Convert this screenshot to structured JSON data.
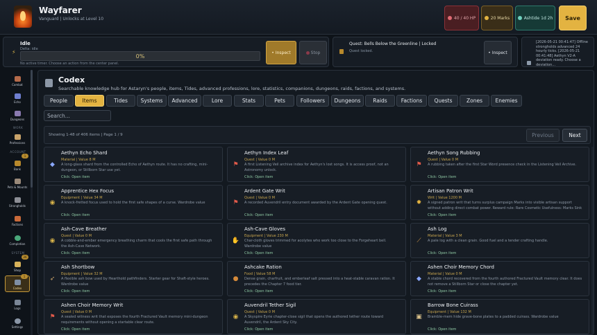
{
  "header": {
    "title": "Wayfarer",
    "subtitle": "Vanguard | Unlocks at Level 10",
    "hp": "40 / 40 HP",
    "marks": "20 Marks",
    "time": "Ashtide 1d 2h",
    "save_label": "Save",
    "colors": {
      "accent": "#e3b341",
      "hp": "#8b3138",
      "time": "#2d7a6e"
    }
  },
  "activity": {
    "title": "Idle",
    "delta": "Delta: idle",
    "progress_label": "0%",
    "progress_fraction": 0,
    "hint": "No active timer. Choose an action from the center panel.",
    "inspect_label": "Inspect",
    "stop_label": "Stop",
    "quest_title": "Quest: Bells Below the Greenline | Locked",
    "quest_sub": "Quest locked.",
    "quest_inspect_label": "Inspect",
    "log_text": "[2026-05-21 00:41:47] Offline strongholds advanced 24 hourly ticks. [2026-05-21 00:41:48] Aethyn V2-A deviation ready. Choose a deviation…"
  },
  "sidebar": {
    "items": [
      {
        "label": "Combat",
        "icon": "swords-icon"
      },
      {
        "label": "Echo",
        "icon": "echo-icon"
      },
      {
        "label": "Dungeons",
        "icon": "dungeon-icon"
      },
      {
        "label": "Professions",
        "icon": "tools-icon"
      },
      {
        "label": "Bank",
        "icon": "bank-icon",
        "badge": "1"
      },
      {
        "label": "Pets & Mounts",
        "icon": "paw-icon"
      },
      {
        "label": "Strongholds",
        "icon": "castle-icon"
      },
      {
        "label": "Factions",
        "icon": "banner-icon"
      },
      {
        "label": "Completion",
        "icon": "check-icon"
      },
      {
        "label": "Shop",
        "icon": "shop-icon",
        "badge": "26"
      },
      {
        "label": "Codex",
        "icon": "book-icon",
        "badge": "1",
        "active": true
      },
      {
        "label": "Logs",
        "icon": "scroll-icon"
      },
      {
        "label": "Settings",
        "icon": "gear-icon"
      }
    ],
    "sections": {
      "work": "WORK",
      "account": "ACCOUNT",
      "system": "SYSTEM"
    }
  },
  "codex": {
    "title": "Codex",
    "subtitle": "Searchable knowledge hub for Astaryn's people, items, Tides, advanced professions, lore, statistics, companions, dungeons, raids, factions, and systems.",
    "tabs": [
      "People",
      "Items",
      "Tides",
      "Systems",
      "Advanced",
      "Lore",
      "Stats",
      "Pets",
      "Followers",
      "Dungeons",
      "Raids",
      "Factions",
      "Quests",
      "Zones",
      "Enemies"
    ],
    "active_tab": "Items",
    "search_placeholder": "Search...",
    "showing": "Showing 1-48 of 406 items | Page 1 / 9",
    "prev_label": "Previous",
    "next_label": "Next",
    "open_label": "Click: Open item",
    "cards": [
      {
        "title": "Aethyn Echo Shard",
        "meta": "Material | Value 8 M",
        "desc": "A long-glass shard from the controlled Echo of Aethyn route. It has no crafting, mini-dungeon, or Stillborn Star use yet.",
        "icon": "crystal-icon",
        "glyph": "◆",
        "color": "#8aa8ff"
      },
      {
        "title": "Aethyn Index Leaf",
        "meta": "Quest | Value 0 M",
        "desc": "A first Listening Veil archive index for Aethyn's lost songs. It is access proof, not an Astronomy unlock.",
        "icon": "flag-icon",
        "glyph": "⚑",
        "color": "#e05a4a"
      },
      {
        "title": "Aethyn Song Rubbing",
        "meta": "Quest | Value 0 M",
        "desc": "A rubbing taken after the first Star Word presence check in the Listening Veil Archive.",
        "icon": "flag-icon",
        "glyph": "⚑",
        "color": "#e05a4a"
      },
      {
        "title": "Apprentice Hex Focus",
        "meta": "Equipment | Value 34 M",
        "desc": "A knock-fretted focus used to hold the first safe shapes of a curse. Wardrobe value",
        "icon": "amulet-icon",
        "glyph": "◉",
        "color": "#d9b44a"
      },
      {
        "title": "Ardent Gate Writ",
        "meta": "Quest | Value 0 M",
        "desc": "A recorded Auvendril entry document awarded by the Ardent Gate opening quest.",
        "icon": "flag-icon",
        "glyph": "⚑",
        "color": "#e05a4a"
      },
      {
        "title": "Artisan Patron Writ",
        "meta": "Writ | Value 1200 M",
        "desc": "A signed patron writ that turns surplus campaign Marks into visible artisan support without adding direct combat power. Reward rule: Rare Cosmetic Usefulness: Marks Sink Prestige.",
        "icon": "seal-icon",
        "glyph": "✹",
        "color": "#e3b341"
      },
      {
        "title": "Ash-Cave Breather",
        "meta": "Quest | Value 0 M",
        "desc": "A cobble-and-ember emergency breathing charm that cools the first safe path through the Ash-Cave Network.",
        "icon": "amulet-icon",
        "glyph": "◉",
        "color": "#d9b44a"
      },
      {
        "title": "Ash-Cave Gloves",
        "meta": "Equipment | Value 230 M",
        "desc": "Char-cloth gloves trimmed for acolytes who work too close to the Forgeheart bell. Wardrobe value",
        "icon": "glove-icon",
        "glyph": "✋",
        "color": "#e0c290"
      },
      {
        "title": "Ash Log",
        "meta": "Material | Value 3 M",
        "desc": "A pale log with a clean grain. Good fuel and a tender crafting handle.",
        "icon": "log-icon",
        "glyph": "⟋",
        "color": "#d79a4a"
      },
      {
        "title": "Ash Shortbow",
        "meta": "Equipment | Value 32 M",
        "desc": "A flexible ash bow used by Hearthold pathfinders. Starter gear for Shaft-style heroes. Wardrobe value",
        "icon": "bow-icon",
        "glyph": "➶",
        "color": "#c9a36a"
      },
      {
        "title": "Ashcake Ration",
        "meta": "Food | Value 58 M",
        "desc": "Dense grain, charfruit, and emberleaf salt pressed into a heat-stable caravan ration. It precedes the Chapter 7 food tier.",
        "icon": "bread-icon",
        "glyph": "●",
        "color": "#d58a3a"
      },
      {
        "title": "Ashen Choir Memory Chord",
        "meta": "Material | Value 0 M",
        "desc": "A stable chord recovered from the fourth authored Fractured Vault memory clear. It does not remove a Stillborn Star or close the chapter yet.",
        "icon": "crystal-icon",
        "glyph": "◆",
        "color": "#8aa8ff"
      },
      {
        "title": "Ashen Choir Memory Writ",
        "meta": "Quest | Value 0 M",
        "desc": "A sealed witness writ that exposes the fourth Fractured Vault memory mini-dungeon requirements without opening a startable clear route.",
        "icon": "flag-icon",
        "glyph": "⚑",
        "color": "#e05a4a"
      },
      {
        "title": "Auvendril Tether Sigil",
        "meta": "Quest | Value 0 M",
        "desc": "A Skyspire Eyrie chapter-close sigil that opens the authored tether route toward Auvendril, the Ardent Sky City.",
        "icon": "amulet-icon",
        "glyph": "◉",
        "color": "#d9b44a"
      },
      {
        "title": "Barrow Bone Cuirass",
        "meta": "Equipment | Value 132 M",
        "desc": "Bramble-mem hide grave-bone plates to a padded cuirass. Wardrobe value",
        "icon": "armor-icon",
        "glyph": "▣",
        "color": "#d9c08a"
      }
    ]
  }
}
